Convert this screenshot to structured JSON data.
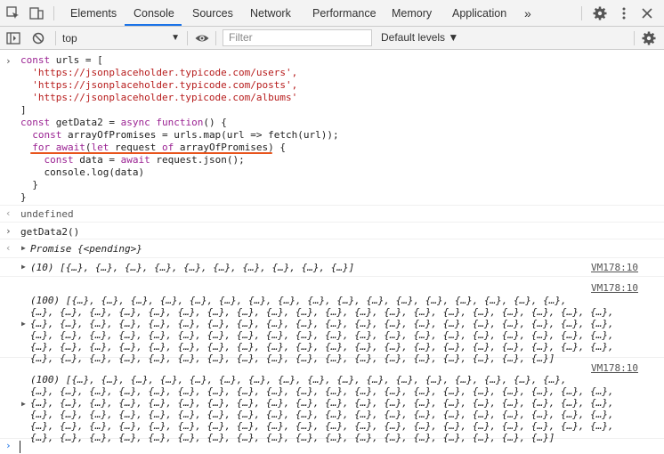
{
  "tabs": {
    "items": [
      "Elements",
      "Console",
      "Sources",
      "Network",
      "Performance",
      "Memory",
      "Application"
    ],
    "more": "»",
    "active": "Console"
  },
  "toolbar": {
    "context": "top",
    "filter_placeholder": "Filter",
    "levels": "Default levels ▼"
  },
  "console": {
    "code_lines": [
      "const urls = [",
      "  'https://jsonplaceholder.typicode.com/users',",
      "  'https://jsonplaceholder.typicode.com/posts',",
      "  'https://jsonplaceholder.typicode.com/albums'",
      "]",
      "const getData2 = async function() {",
      "  const arrayOfPromises = urls.map(url => fetch(url));",
      "  for await(let request of arrayOfPromises) {",
      "    const data = await request.json();",
      "    console.log(data)",
      "  }",
      "}"
    ],
    "undefined_text": "undefined",
    "call_text": "getData2()",
    "promise_text": "Promise {<pending>}",
    "log1": {
      "source": "VM178:10",
      "text": "(10) [{…}, {…}, {…}, {…}, {…}, {…}, {…}, {…}, {…}, {…}]"
    },
    "log2": {
      "source": "VM178:10",
      "lines": [
        "(100) [{…}, {…}, {…}, {…}, {…}, {…}, {…}, {…}, {…}, {…}, {…}, {…}, {…}, {…}, {…}, {…}, {…},",
        "{…}, {…}, {…}, {…}, {…}, {…}, {…}, {…}, {…}, {…}, {…}, {…}, {…}, {…}, {…}, {…}, {…}, {…}, {…}, {…},",
        "{…}, {…}, {…}, {…}, {…}, {…}, {…}, {…}, {…}, {…}, {…}, {…}, {…}, {…}, {…}, {…}, {…}, {…}, {…}, {…},",
        "{…}, {…}, {…}, {…}, {…}, {…}, {…}, {…}, {…}, {…}, {…}, {…}, {…}, {…}, {…}, {…}, {…}, {…}, {…}, {…},",
        "{…}, {…}, {…}, {…}, {…}, {…}, {…}, {…}, {…}, {…}, {…}, {…}, {…}, {…}, {…}, {…}, {…}, {…}, {…}, {…},",
        "{…}, {…}, {…}, {…}, {…}, {…}, {…}, {…}, {…}, {…}, {…}, {…}, {…}, {…}, {…}, {…}, {…}, {…}]"
      ]
    },
    "log3": {
      "source": "VM178:10",
      "lines": [
        "(100) [{…}, {…}, {…}, {…}, {…}, {…}, {…}, {…}, {…}, {…}, {…}, {…}, {…}, {…}, {…}, {…}, {…},",
        "{…}, {…}, {…}, {…}, {…}, {…}, {…}, {…}, {…}, {…}, {…}, {…}, {…}, {…}, {…}, {…}, {…}, {…}, {…}, {…},",
        "{…}, {…}, {…}, {…}, {…}, {…}, {…}, {…}, {…}, {…}, {…}, {…}, {…}, {…}, {…}, {…}, {…}, {…}, {…}, {…},",
        "{…}, {…}, {…}, {…}, {…}, {…}, {…}, {…}, {…}, {…}, {…}, {…}, {…}, {…}, {…}, {…}, {…}, {…}, {…}, {…},",
        "{…}, {…}, {…}, {…}, {…}, {…}, {…}, {…}, {…}, {…}, {…}, {…}, {…}, {…}, {…}, {…}, {…}, {…}, {…}, {…},",
        "{…}, {…}, {…}, {…}, {…}, {…}, {…}, {…}, {…}, {…}, {…}, {…}, {…}, {…}, {…}, {…}, {…}, {…}]"
      ]
    }
  },
  "colors": {
    "accent": "#1a73e8",
    "highlight_underline": "#e8541c",
    "keyword": "#9b2393",
    "string": "#b71c1c"
  }
}
